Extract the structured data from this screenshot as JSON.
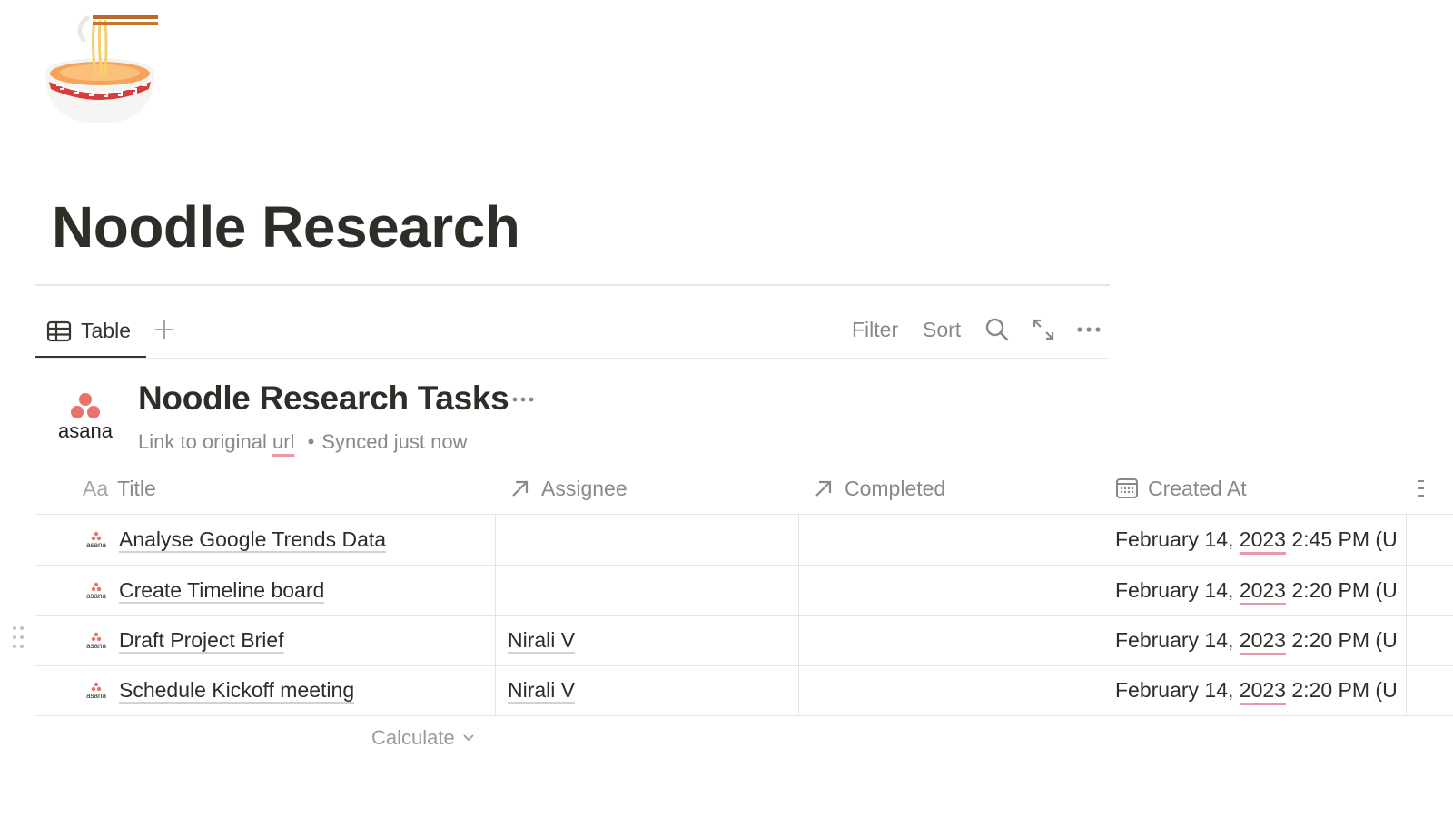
{
  "page": {
    "icon": "ramen-bowl-icon",
    "title": "Noodle Research"
  },
  "views": {
    "active_tab": "Table",
    "add_view_icon": "plus-icon",
    "toolbar": {
      "filter": "Filter",
      "sort": "Sort",
      "search_icon": "search-icon",
      "expand_icon": "expand-icon",
      "more_icon": "more-icon"
    }
  },
  "database": {
    "logo": "asana",
    "title": "Noodle Research Tasks",
    "link_prefix": "Link to original",
    "link_text": "url",
    "separator": "•",
    "sync_status": "Synced just now"
  },
  "table": {
    "columns": [
      {
        "label": "Title",
        "icon": "Aa"
      },
      {
        "label": "Assignee",
        "icon": "relation-arrow-icon"
      },
      {
        "label": "Completed",
        "icon": "relation-arrow-icon"
      },
      {
        "label": "Created At",
        "icon": "calendar-icon"
      }
    ],
    "rows": [
      {
        "title": "Analyse Google Trends Data",
        "assignee": "",
        "completed": "",
        "created_prefix": "February 14, ",
        "created_year": "2023",
        "created_suffix": " 2:45 PM (U"
      },
      {
        "title": "Create Timeline board",
        "assignee": "",
        "completed": "",
        "created_prefix": "February 14, ",
        "created_year": "2023",
        "created_suffix": " 2:20 PM (U"
      },
      {
        "title": "Draft Project Brief",
        "assignee": "Nirali V",
        "completed": "",
        "created_prefix": "February 14, ",
        "created_year": "2023",
        "created_suffix": " 2:20 PM (U"
      },
      {
        "title": "Schedule Kickoff meeting",
        "assignee": "Nirali V",
        "completed": "",
        "created_prefix": "February 14, ",
        "created_year": "2023",
        "created_suffix": " 2:20 PM (U"
      }
    ],
    "calculate_label": "Calculate"
  },
  "colors": {
    "text": "#37352f",
    "muted": "#8a8986",
    "asana_coral": "#e8736b",
    "year_underline": "#e59aa6"
  }
}
